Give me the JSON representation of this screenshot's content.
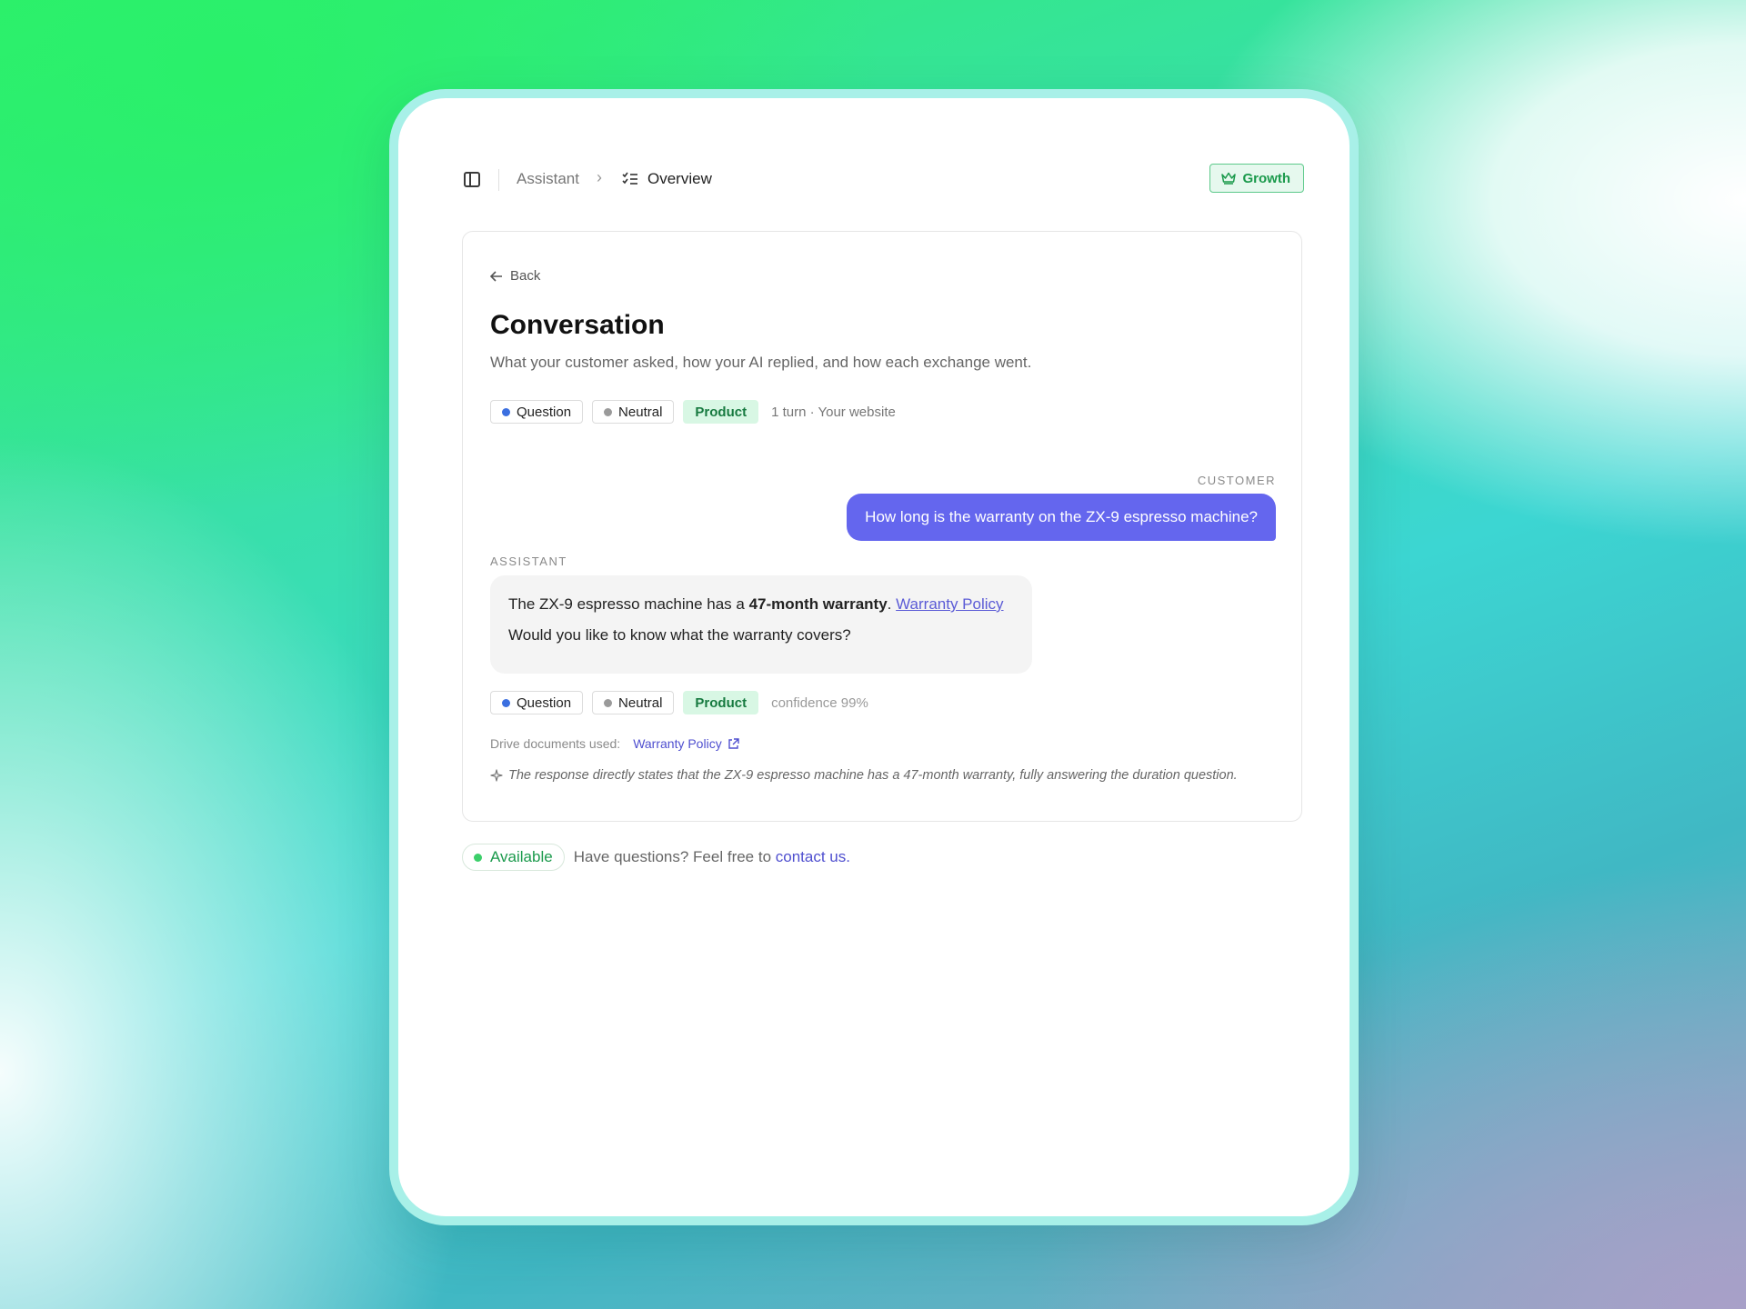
{
  "header": {
    "breadcrumb_root": "Assistant",
    "breadcrumb_separator": "›",
    "breadcrumb_current": "Overview",
    "plan_badge": "Growth"
  },
  "conversation": {
    "back_label": "Back",
    "title": "Conversation",
    "subtitle": "What your customer asked, how your AI replied, and how each exchange went.",
    "tags": {
      "intent": "Question",
      "sentiment": "Neutral",
      "topic": "Product",
      "meta": "1 turn · Your website"
    },
    "customer_label": "CUSTOMER",
    "customer_message": "How long is the warranty on the ZX-9 espresso machine?",
    "assistant_label": "ASSISTANT",
    "assistant_line1_prefix": "The ZX-9 espresso machine has a ",
    "assistant_line1_bold": "47-month warranty",
    "assistant_line1_suffix": ". ",
    "assistant_line1_link": "Warranty Policy",
    "assistant_line2": "Would you like to know what the warranty covers?",
    "reply_tags": {
      "intent": "Question",
      "sentiment": "Neutral",
      "topic": "Product",
      "confidence": "confidence 99%"
    },
    "drive_label": "Drive documents used:",
    "drive_doc": "Warranty Policy",
    "reasoning": "The response directly states that the ZX-9 espresso machine has a 47-month warranty, fully answering the duration question."
  },
  "footer": {
    "status": "Available",
    "text": "Have questions? Feel free to ",
    "link": "contact us."
  },
  "colors": {
    "accent": "#6466ee",
    "question_dot": "#3b6fe0",
    "neutral_dot": "#9a9a9a",
    "success": "#1b9a4c"
  },
  "icons": [
    "sidebar-toggle-icon",
    "checklist-icon",
    "crown-icon",
    "arrow-left-icon",
    "external-link-icon",
    "sparkle-icon"
  ]
}
